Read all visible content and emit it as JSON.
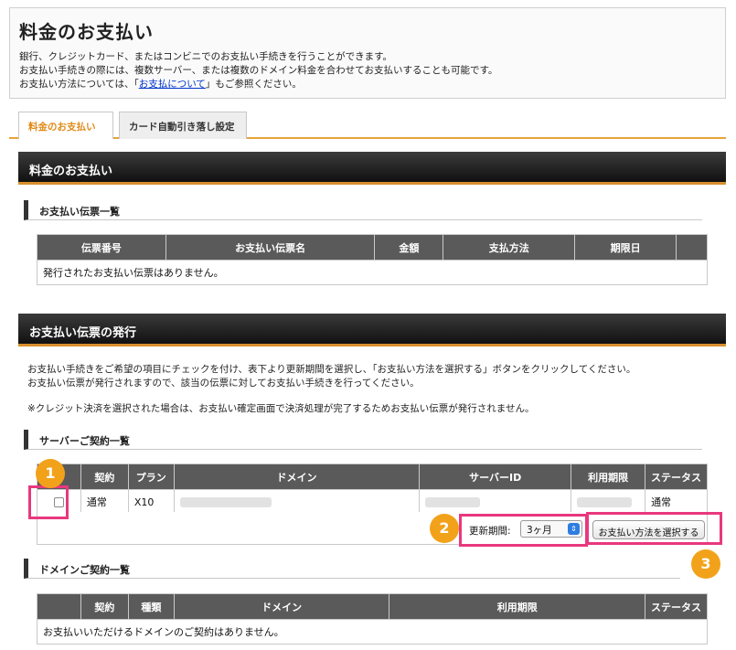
{
  "page": {
    "title": "料金のお支払い",
    "intro_line1": "銀行、クレジットカード、またはコンビニでのお支払い手続きを行うことができます。",
    "intro_line2": "お支払い手続きの際には、複数サーバー、または複数のドメイン料金を合わせてお支払いすることも可能です。",
    "intro_line3_before": "お支払い方法については、「",
    "intro_line3_link": "お支払について",
    "intro_line3_after": "」もご参照ください。"
  },
  "tabs": [
    {
      "label": "料金のお支払い",
      "active": true
    },
    {
      "label": "カード自動引き落し設定",
      "active": false
    }
  ],
  "section1": {
    "title": "料金のお支払い",
    "subheading": "お支払い伝票一覧",
    "columns": [
      "伝票番号",
      "お支払い伝票名",
      "金額",
      "支払方法",
      "期限日",
      ""
    ],
    "empty_message": "発行されたお支払い伝票はありません。"
  },
  "section2": {
    "title": "お支払い伝票の発行",
    "text_line1": "お支払い手続きをご希望の項目にチェックを付け、表下より更新期間を選択し、「お支払い方法を選択する」ボタンをクリックしてください。",
    "text_line2": "お支払い伝票が発行されますので、該当の伝票に対してお支払い手続きを行ってください。",
    "note": "※クレジット決済を選択された場合は、お支払い確定画面で決済処理が完了するためお支払い伝票が発行されません。",
    "server_subheading": "サーバーご契約一覧",
    "server_columns": [
      "",
      "契約",
      "プラン",
      "ドメイン",
      "サーバーID",
      "利用期限",
      "ステータス"
    ],
    "server_rows": [
      {
        "contract": "通常",
        "plan": "X10",
        "status": "通常"
      }
    ],
    "period_label": "更新期間:",
    "period_value": "3ヶ月",
    "select_button": "お支払い方法を選択する",
    "domain_subheading": "ドメインご契約一覧",
    "domain_columns": [
      "",
      "契約",
      "種類",
      "ドメイン",
      "利用期限",
      "ステータス"
    ],
    "domain_empty_message": "お支払いいただけるドメインのご契約はありません。"
  },
  "annotations": {
    "badge1": "1",
    "badge2": "2",
    "badge3": "3"
  },
  "colors": {
    "accent_orange": "#e08a17",
    "badge_orange": "#f2a21a",
    "highlight_pink": "#e8387d",
    "bar_dark": "#1a1a1a",
    "table_header": "#5a5a5a",
    "link_blue": "#0033cc"
  },
  "icons": {
    "select_arrows": "updown-arrows-icon"
  }
}
